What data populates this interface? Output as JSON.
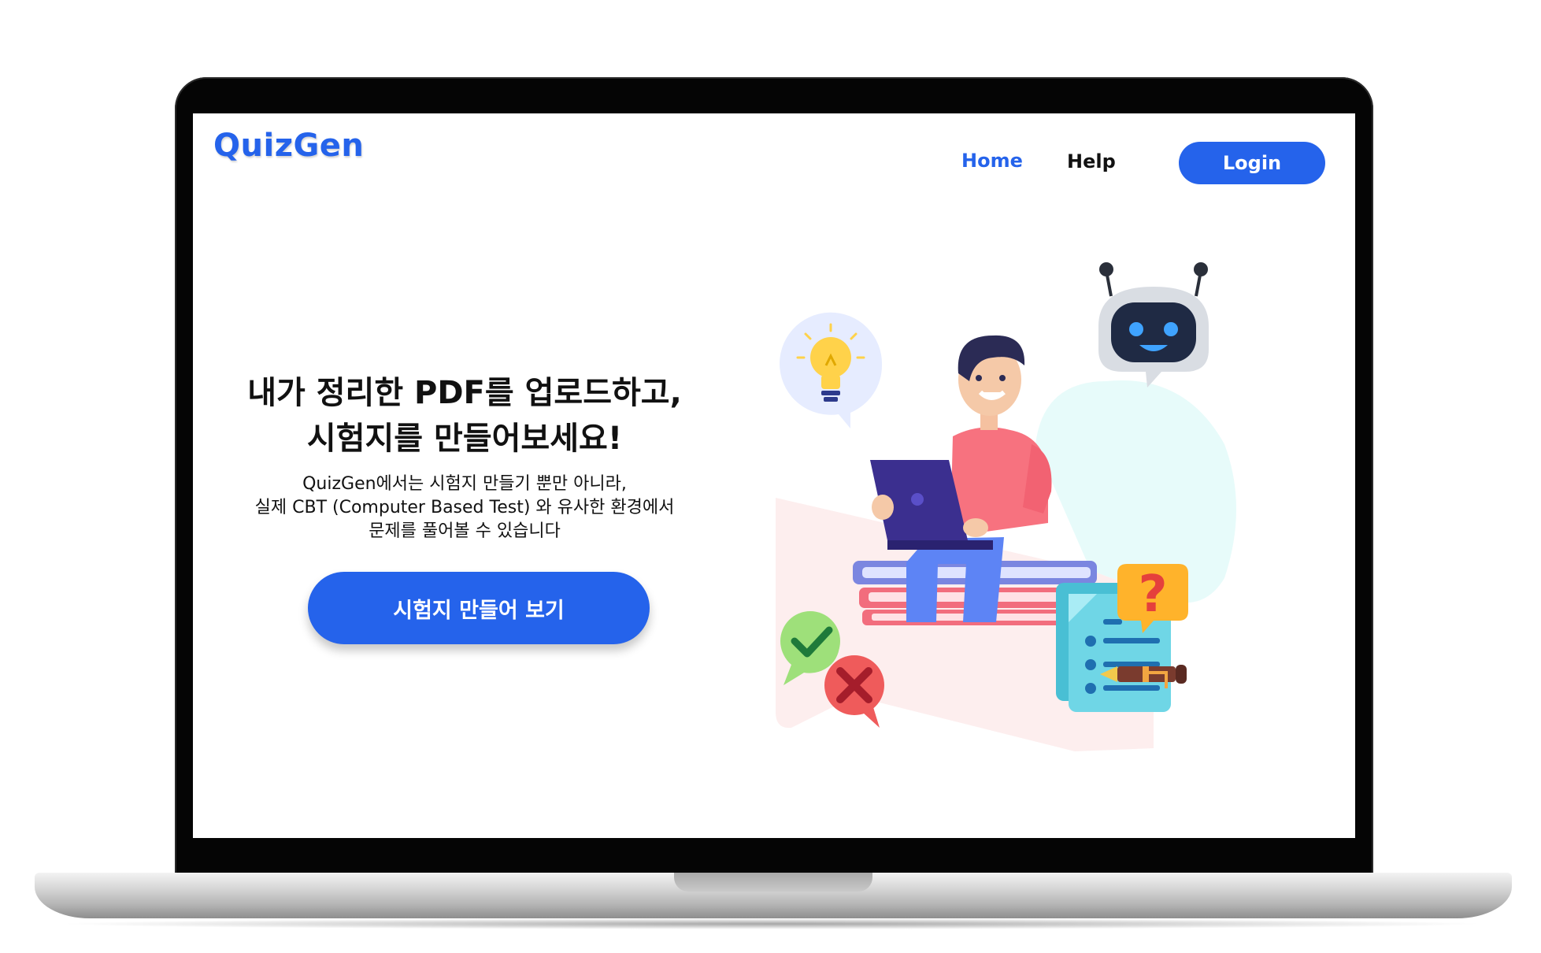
{
  "site": {
    "logo": "QuizGen"
  },
  "nav": {
    "home_label": "Home",
    "help_label": "Help",
    "login_label": "Login"
  },
  "hero": {
    "title_line1": "내가 정리한 PDF를 업로드하고,",
    "title_line2": "시험지를 만들어보세요!",
    "desc_line1": "QuizGen에서는 시험지 만들기 뿐만 아니라,",
    "desc_line2": "실제 CBT (Computer Based Test) 와 유사한 환경에서",
    "desc_line3": "문제를 풀어볼 수 있습니다",
    "cta_label": "시험지 만들어 보기"
  },
  "colors": {
    "brand_blue": "#2563eb",
    "text_dark": "#111111",
    "shirt_pink": "#f7727f",
    "laptop_purple": "#3b2f8f",
    "robot_navy": "#1f2a44"
  },
  "icons": [
    "lightbulb-icon",
    "robot-icon",
    "question-mark-icon",
    "checkmark-icon",
    "cross-icon",
    "checklist-document-icon",
    "pen-icon"
  ]
}
